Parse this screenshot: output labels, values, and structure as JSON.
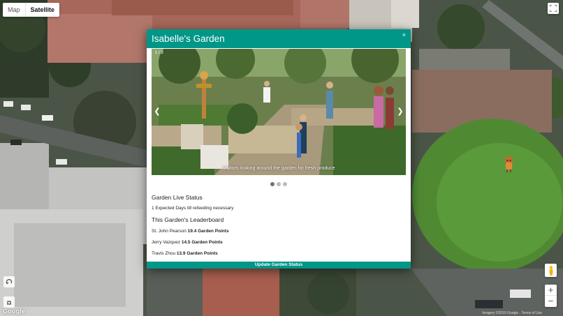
{
  "map": {
    "type_options": [
      "Map",
      "Satellite"
    ],
    "selected_type": "Satellite",
    "logo": "Google",
    "terms": "Imagery ©2019 Google · Terms of Use",
    "zoom_in": "+",
    "zoom_out": "−",
    "colors": {
      "grass": "#3f6b2c",
      "roof": "#b9705f",
      "road": "#5c615e"
    }
  },
  "modal": {
    "title": "Isabelle's Garden",
    "close": "×",
    "carousel": {
      "counter": "1 / 3",
      "caption": "Visitors looking around the garden for fresh produce",
      "prev": "❮",
      "next": "❯",
      "slide_count": 3,
      "active_index": 0
    },
    "status_heading": "Garden Live Status",
    "status_text": "1 Expected Days till refeeding necessary",
    "leaderboard_heading": "This Garden's Leaderboard",
    "leaderboard": [
      {
        "name": "St. John Pearson",
        "points": "19.4 Garden Points"
      },
      {
        "name": "Jerry Vazquez",
        "points": "14.5 Garden Points"
      },
      {
        "name": "Travis Zhou",
        "points": "13.9 Garden Points"
      }
    ],
    "update_button": "Update Garden Status",
    "accent": "#009688"
  }
}
